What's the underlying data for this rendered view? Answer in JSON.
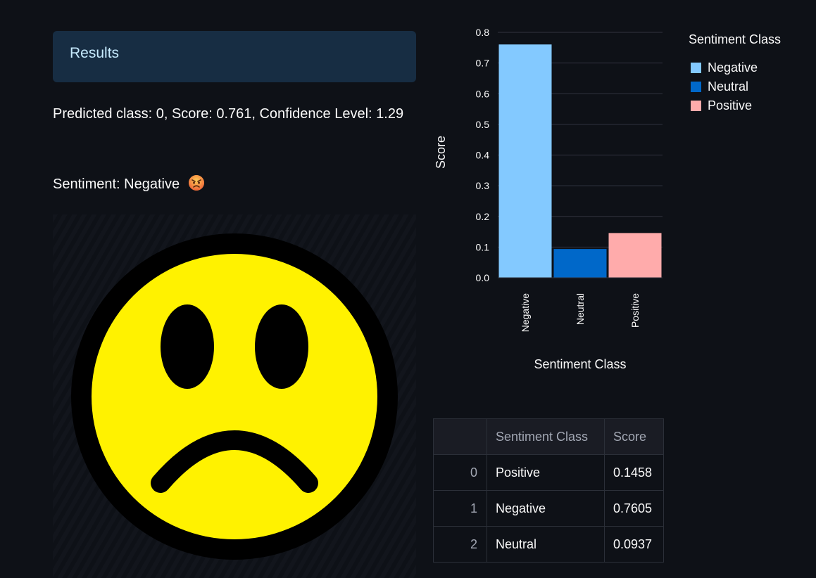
{
  "results": {
    "title": "Results"
  },
  "prediction": {
    "text": "Predicted class: 0, Score: 0.761, Confidence Level: 1.29",
    "sentiment_text": "Sentiment: Negative",
    "emoji_icon": "angry-face-icon"
  },
  "image": {
    "icon": "sad-face-icon"
  },
  "chart_data": {
    "type": "bar",
    "categories": [
      "Negative",
      "Neutral",
      "Positive"
    ],
    "values": [
      0.7605,
      0.0937,
      0.1458
    ],
    "colors": [
      "#83c9ff",
      "#0068c9",
      "#ffabab"
    ],
    "xlabel": "Sentiment Class",
    "ylabel": "Score",
    "ylim": [
      0,
      0.8
    ],
    "yticks": [
      "0.0",
      "0.1",
      "0.2",
      "0.3",
      "0.4",
      "0.5",
      "0.6",
      "0.7",
      "0.8"
    ],
    "grid": true,
    "legend": {
      "title": "Sentiment Class",
      "placement": "right",
      "entries": [
        "Negative",
        "Neutral",
        "Positive"
      ]
    }
  },
  "table": {
    "headers": [
      "",
      "Sentiment Class",
      "Score"
    ],
    "rows": [
      {
        "index": "0",
        "cls": "Positive",
        "score": "0.1458"
      },
      {
        "index": "1",
        "cls": "Negative",
        "score": "0.7605"
      },
      {
        "index": "2",
        "cls": "Neutral",
        "score": "0.0937"
      }
    ]
  }
}
